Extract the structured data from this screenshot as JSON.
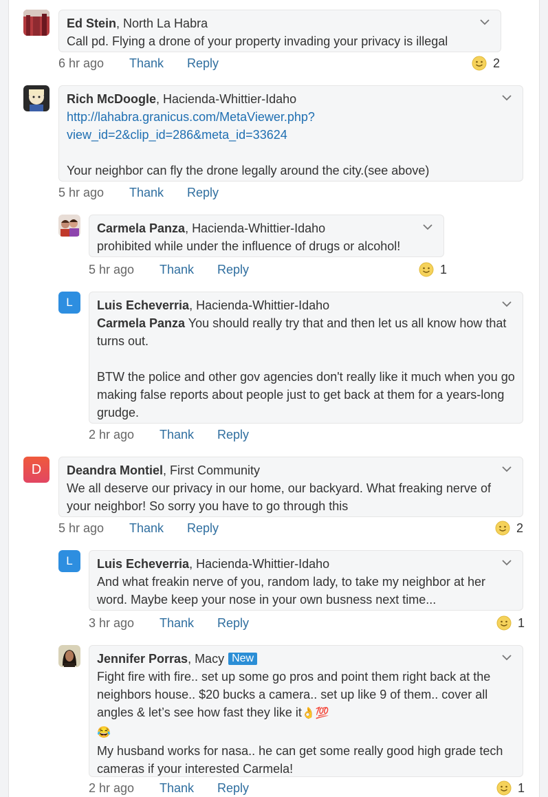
{
  "actions": {
    "thank": "Thank",
    "reply": "Reply"
  },
  "comments": [
    {
      "author": "Ed Stein",
      "neighborhood": ", North La Habra",
      "text": "Call pd.  Flying a drone of your property invading your privacy is illegal",
      "time": "6 hr ago",
      "reactions": "2"
    },
    {
      "author": "Rich McDoogle",
      "neighborhood": ", Hacienda-Whittier-Idaho",
      "link_line1": "http://lahabra.granicus.com/MetaViewer.php?",
      "link_line2": "view_id=2&clip_id=286&meta_id=33624",
      "text": "Your neighbor can fly the drone legally around the city.(see above)",
      "time": "5 hr ago"
    },
    {
      "author": "Carmela Panza",
      "neighborhood": ", Hacienda-Whittier-Idaho",
      "text": "prohibited while under the influence of drugs or alcohol!",
      "time": "5 hr ago",
      "reactions": "1"
    },
    {
      "author": "Luis Echeverria",
      "avatar_letter": "L",
      "neighborhood": ", Hacienda-Whittier-Idaho",
      "mention": "Carmela Panza",
      "text": " You should really try that and then let us all know how that turns out.",
      "text2": "BTW the police and other gov agencies don't really like it much when you go making false reports about people just to get back at them for a years-long grudge.",
      "time": "2 hr ago"
    },
    {
      "author": "Deandra Montiel",
      "avatar_letter": "D",
      "neighborhood": ", First Community",
      "text": "We all deserve our privacy in our home, our backyard. What freaking nerve of your neighbor! So sorry you have to go through this",
      "time": "5 hr ago",
      "reactions": "2"
    },
    {
      "author": "Luis Echeverria",
      "avatar_letter": "L",
      "neighborhood": ", Hacienda-Whittier-Idaho",
      "text": "And what freakin nerve of you, random lady, to take my neighbor at her word. Maybe keep your nose in your own busness next time...",
      "time": "3 hr ago",
      "reactions": "1"
    },
    {
      "author": "Jennifer Porras",
      "neighborhood": ", Macy",
      "badge": "New",
      "text": "Fight fire with fire.. set up some go pros and point them right back at the neighbors house.. $20 bucks a camera.. set up like 9 of them.. cover all angles & let’s see how fast they like it",
      "emoji1": "👌💯",
      "emoji2": "😂",
      "text2": "My husband works for nasa.. he can get some really good high grade tech cameras if your interested Carmela!",
      "time": "2 hr ago",
      "reactions": "1"
    }
  ],
  "colors": {
    "link": "#1f6fb2",
    "action": "#2f6e9f",
    "luis_avatar": "#2d8ee0",
    "deandra_avatar": "#ef5a3c",
    "new_badge": "#2b8ed6"
  }
}
